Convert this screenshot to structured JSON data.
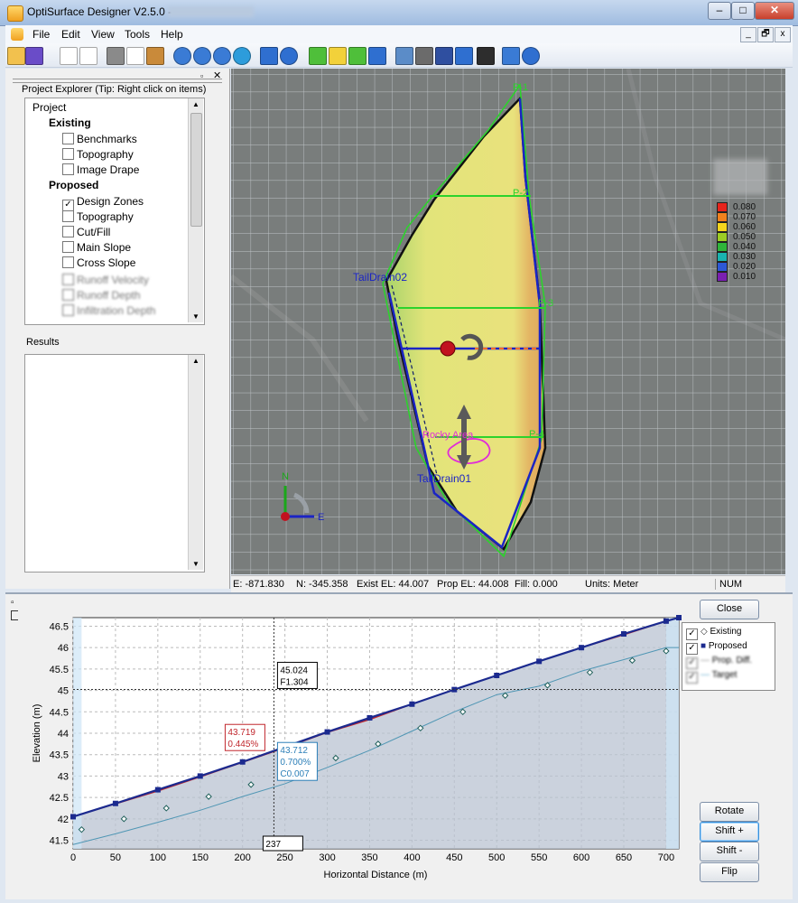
{
  "window": {
    "title": "OptiSurface Designer V2.5.0 -",
    "min": "–",
    "max": "□",
    "close": "✕"
  },
  "menu": [
    "File",
    "Edit",
    "View",
    "Tools",
    "Help"
  ],
  "mdi": {
    "min": "_",
    "restore": "🗗",
    "close": "x"
  },
  "toolbar_icons": [
    "open-icon",
    "save-icon",
    "new-icon",
    "new-doc-icon",
    "print-icon",
    "print-preview-icon",
    "paste-icon",
    "zoom-in-icon",
    "zoom-out-icon",
    "zoom-pan-icon",
    "globe-icon",
    "move-icon",
    "rotate-icon",
    "green-box-icon",
    "yellow-box-icon",
    "green-cube-icon",
    "refresh-icon",
    "layers-icon",
    "calculator-icon",
    "profile-icon",
    "fill-icon",
    "text-icon",
    "export-icon",
    "help-icon"
  ],
  "explorer": {
    "caption": "Project Explorer (Tip: Right click on items)",
    "root": "Project",
    "existing_heading": "Existing",
    "existing_items": [
      {
        "label": "Benchmarks",
        "checked": false
      },
      {
        "label": "Topography",
        "checked": false
      },
      {
        "label": "Image Drape",
        "checked": false
      }
    ],
    "proposed_heading": "Proposed",
    "proposed_items": [
      {
        "label": "Design Zones",
        "checked": true
      },
      {
        "label": "Topography",
        "checked": false
      },
      {
        "label": "Cut/Fill",
        "checked": false
      },
      {
        "label": "Main Slope",
        "checked": false
      },
      {
        "label": "Cross Slope",
        "checked": false
      }
    ],
    "blurred_items": [
      "Runoff Velocity",
      "Runoff Depth",
      "Infiltration Depth"
    ]
  },
  "results": {
    "caption": "Results"
  },
  "map": {
    "labels": {
      "p1": "P-1",
      "p2": "P-2",
      "p3": "P-3",
      "p4": "P-4",
      "tail2": "TailDrain02",
      "tail1": "TailDrain01",
      "rocky": "Rocky Area",
      "north": "N",
      "east": "E"
    },
    "scale": [
      {
        "value": "0.080",
        "color": "#e8241c"
      },
      {
        "value": "0.070",
        "color": "#f2811e"
      },
      {
        "value": "0.060",
        "color": "#f5d51d"
      },
      {
        "value": "0.050",
        "color": "#9ccd24"
      },
      {
        "value": "0.040",
        "color": "#2fb53a"
      },
      {
        "value": "0.030",
        "color": "#19b3b0"
      },
      {
        "value": "0.020",
        "color": "#2c58d6"
      },
      {
        "value": "0.010",
        "color": "#7a1fb1"
      }
    ]
  },
  "status": {
    "e": "E: -871.830",
    "n": "N: -345.358",
    "exist": "Exist EL: 44.007",
    "prop": "Prop EL: 44.008",
    "fill": "Fill: 0.000",
    "units": "Units: Meter",
    "num": "NUM"
  },
  "buttons": {
    "close": "Close",
    "rotate": "Rotate",
    "shift_plus": "Shift +",
    "shift_minus": "Shift -",
    "flip": "Flip"
  },
  "chart_data": {
    "type": "line",
    "xlabel": "Horizontal Distance (m)",
    "ylabel": "Elevation (m)",
    "xlim": [
      0,
      715
    ],
    "ylim": [
      41.3,
      46.7
    ],
    "xticks": [
      0,
      50,
      100,
      150,
      200,
      250,
      300,
      350,
      400,
      450,
      500,
      550,
      600,
      650,
      700
    ],
    "yticks": [
      41.5,
      42,
      42.5,
      43,
      43.5,
      44,
      44.5,
      45,
      45.5,
      46,
      46.5
    ],
    "series": [
      {
        "name": "Existing",
        "x": [
          0,
          50,
          100,
          150,
          200,
          250,
          300,
          350,
          400,
          450,
          500,
          550,
          600,
          650,
          700,
          715
        ],
        "values": [
          42.05,
          42.35,
          42.65,
          42.98,
          43.32,
          43.66,
          44.02,
          44.32,
          44.68,
          45.02,
          45.35,
          45.68,
          46.0,
          46.3,
          46.62,
          46.7
        ]
      },
      {
        "name": "Proposed",
        "x": [
          0,
          50,
          100,
          150,
          200,
          250,
          300,
          350,
          400,
          450,
          500,
          550,
          600,
          650,
          700,
          715
        ],
        "values": [
          42.05,
          42.36,
          42.68,
          43.0,
          43.33,
          43.68,
          44.03,
          44.36,
          44.68,
          45.02,
          45.35,
          45.68,
          46.0,
          46.32,
          46.62,
          46.7
        ]
      },
      {
        "name": "Prop. Diff.",
        "x": [
          10,
          60,
          110,
          160,
          210,
          260,
          310,
          360,
          410,
          460,
          510,
          560,
          610,
          660,
          700
        ],
        "values": [
          41.75,
          42.0,
          42.25,
          42.52,
          42.8,
          43.1,
          43.42,
          43.75,
          44.12,
          44.5,
          44.88,
          45.12,
          45.42,
          45.7,
          45.92
        ]
      },
      {
        "name": "Target",
        "x": [
          0,
          50,
          100,
          150,
          200,
          250,
          300,
          350,
          400,
          450,
          500,
          550,
          600,
          650,
          700,
          715
        ],
        "values": [
          41.4,
          41.65,
          41.92,
          42.2,
          42.52,
          42.82,
          43.2,
          43.6,
          44.05,
          44.5,
          44.9,
          45.1,
          45.45,
          45.72,
          46.0,
          46.0
        ]
      }
    ],
    "annotations": {
      "cursor": "45.024",
      "cursor_f": "F1.304",
      "x_readout": "237",
      "red_val": "43.719",
      "red_pct": "0.445%",
      "blue_val": "43.712",
      "blue_pct": "0.700%",
      "blue_c": "C0.007"
    },
    "cursor_x": 237,
    "cursor_y": 45.024,
    "legend": [
      {
        "label": "Existing",
        "checked": true
      },
      {
        "label": "Proposed",
        "checked": true
      },
      {
        "label": "Prop. Diff.",
        "checked": true
      },
      {
        "label": "Target",
        "checked": true
      }
    ]
  }
}
